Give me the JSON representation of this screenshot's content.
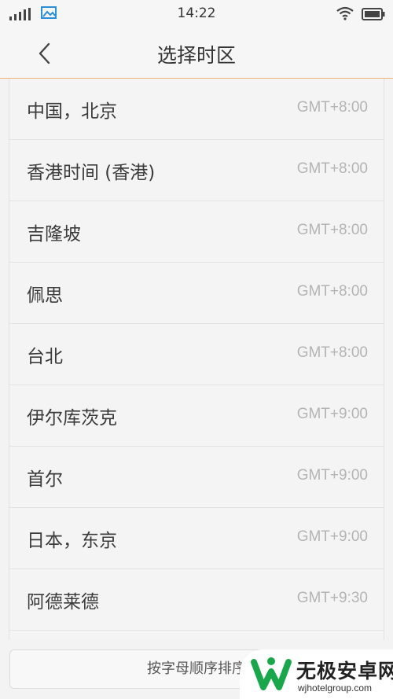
{
  "status_bar": {
    "time": "14:22"
  },
  "header": {
    "title": "选择时区"
  },
  "timezones": [
    {
      "city": "中国，北京",
      "offset": "GMT+8:00"
    },
    {
      "city": "香港时间 (香港)",
      "offset": "GMT+8:00"
    },
    {
      "city": "吉隆坡",
      "offset": "GMT+8:00"
    },
    {
      "city": "佩思",
      "offset": "GMT+8:00"
    },
    {
      "city": "台北",
      "offset": "GMT+8:00"
    },
    {
      "city": "伊尔库茨克",
      "offset": "GMT+9:00"
    },
    {
      "city": "首尔",
      "offset": "GMT+9:00"
    },
    {
      "city": "日本，东京",
      "offset": "GMT+9:00"
    },
    {
      "city": "阿德莱德",
      "offset": "GMT+9:30"
    }
  ],
  "footer": {
    "sort_label": "按字母顺序排序"
  },
  "watermark": {
    "title": "无极安卓网",
    "url": "wjhotelgroup.com"
  },
  "colors": {
    "accent_divider": "#f0b07a",
    "logo_green": "#1aa64a"
  }
}
